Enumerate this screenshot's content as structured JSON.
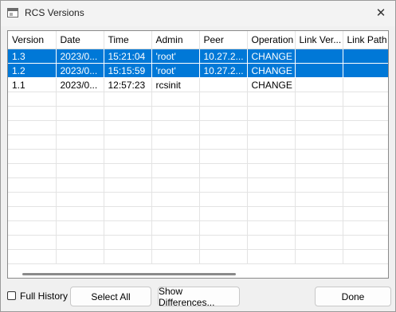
{
  "window": {
    "title": "RCS Versions"
  },
  "table": {
    "columns": [
      "Version",
      "Date",
      "Time",
      "Admin",
      "Peer",
      "Operation",
      "Link Ver...",
      "Link Path"
    ],
    "rows": [
      {
        "version": "1.3",
        "date": "2023/0...",
        "time": "15:21:04",
        "admin": "'root'",
        "peer": "10.27.2...",
        "operation": "CHANGE",
        "link_version": "",
        "link_path": "",
        "selected": true
      },
      {
        "version": "1.2",
        "date": "2023/0...",
        "time": "15:15:59",
        "admin": "'root'",
        "peer": "10.27.2...",
        "operation": "CHANGE",
        "link_version": "",
        "link_path": "",
        "selected": true
      },
      {
        "version": "1.1",
        "date": "2023/0...",
        "time": "12:57:23",
        "admin": "rcsinit",
        "peer": "",
        "operation": "CHANGE",
        "link_version": "",
        "link_path": "",
        "selected": false
      }
    ]
  },
  "footer": {
    "full_history_label": "Full History",
    "full_history_checked": false,
    "select_all_label": "Select All",
    "show_differences_label": "Show Differences...",
    "done_label": "Done"
  },
  "colors": {
    "selection": "#0078d7"
  },
  "icons": {
    "title": "window-app-icon",
    "close": "close-icon"
  }
}
